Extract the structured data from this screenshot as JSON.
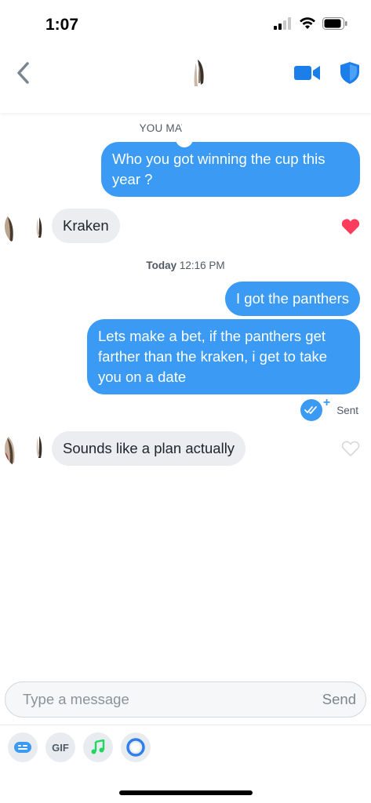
{
  "status_bar": {
    "time": "1:07"
  },
  "header": {
    "back_icon": "chevron-left-icon",
    "video_icon": "video-camera-icon",
    "shield_icon": "shield-icon",
    "accent_color": "#3a9af4"
  },
  "conversation": {
    "match_notice": "YOU MATCHED W",
    "timestamp_day": "Today",
    "timestamp_time": "12:16 PM",
    "messages": [
      {
        "from": "me",
        "text": "Who you got winning the cup this year ?"
      },
      {
        "from": "them",
        "text": "Kraken",
        "liked": true
      },
      {
        "from": "me",
        "text": "I got the panthers"
      },
      {
        "from": "me",
        "text": "Lets make a bet, if the panthers get farther than the kraken, i get to take you on a date"
      },
      {
        "from": "them",
        "text": "Sounds like a plan actually",
        "liked": false
      }
    ],
    "status_label": "Sent",
    "like_color": "#fd3b5a"
  },
  "composer": {
    "placeholder": "Type a message",
    "send_label": "Send"
  },
  "toolbar": {
    "gif_label": "GIF",
    "items": [
      "sticker-icon",
      "gif-icon",
      "music-note-icon",
      "ring-icon"
    ]
  }
}
